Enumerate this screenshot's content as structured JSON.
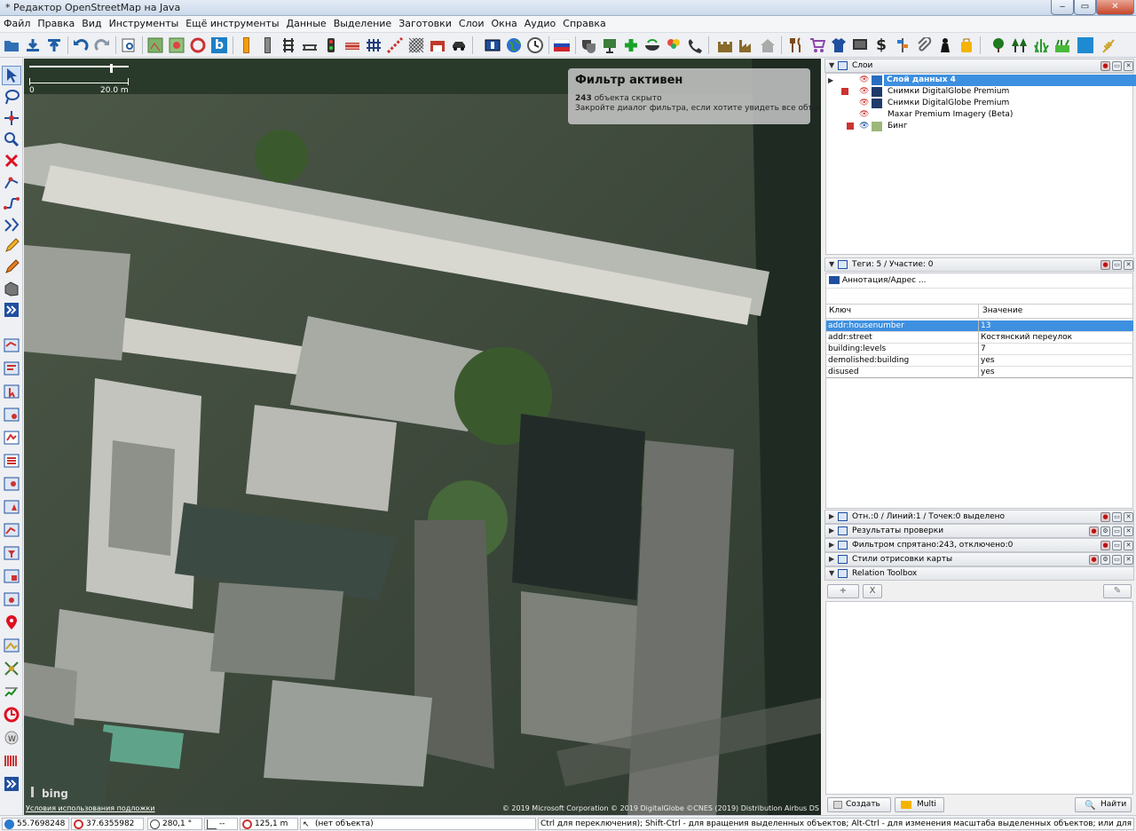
{
  "window": {
    "title": "* Редактор OpenStreetMap на Java",
    "buttons": [
      "‒",
      "▭",
      "✕"
    ]
  },
  "menu": [
    "Файл",
    "Правка",
    "Вид",
    "Инструменты",
    "Ещё инструменты",
    "Данные",
    "Выделение",
    "Заготовки",
    "Слои",
    "Окна",
    "Аудио",
    "Справка"
  ],
  "map": {
    "scale": {
      "zero": "0",
      "end": "20.0 m"
    },
    "filter": {
      "title": "Фильтр активен",
      "count": "243",
      "hidden_text": " объекта скрыто",
      "hint": "Закройте диалог фильтра, если хотите увидеть все объекты."
    },
    "bing_logo": "bing",
    "terms": "Условия использования подложки",
    "attribution": "© 2019 Microsoft Corporation © 2019 DigitalGlobe ©CNES (2019) Distribution Airbus DS"
  },
  "layers_panel": {
    "title": "Слои",
    "items": [
      {
        "label": "Слой данных 4",
        "selected": true
      },
      {
        "label": "Снимки DigitalGlobe Premium",
        "selected": false
      },
      {
        "label": "Снимки DigitalGlobe Premium",
        "selected": false
      },
      {
        "label": "Maxar Premium Imagery (Beta)",
        "selected": false
      },
      {
        "label": "Бинг",
        "selected": false
      }
    ]
  },
  "tags_panel": {
    "title": "Теги: 5 / Участие: 0",
    "preset": "Аннотация/Адрес ...",
    "col_key": "Ключ",
    "col_value": "Значение",
    "rows": [
      {
        "key": "addr:housenumber",
        "value": "13",
        "selected": true
      },
      {
        "key": "addr:street",
        "value": "Костянский переулок",
        "selected": false
      },
      {
        "key": "building:levels",
        "value": "7",
        "selected": false
      },
      {
        "key": "demolished:building",
        "value": "yes",
        "selected": false
      },
      {
        "key": "disused",
        "value": "yes",
        "selected": false
      }
    ]
  },
  "collapsed_panels": [
    {
      "label": "Отн.:0 / Линий:1 / Точек:0 выделено"
    },
    {
      "label": "Результаты проверки"
    },
    {
      "label": "Фильтром спрятано:243, отключено:0"
    },
    {
      "label": "Стили отрисовки карты"
    }
  ],
  "relation_toolbox": {
    "title": "Relation Toolbox",
    "add": "+",
    "remove": "X",
    "edit": "✎"
  },
  "bottom_buttons": {
    "create": "Создать",
    "multi": "Multi",
    "find": "Найти"
  },
  "status": {
    "lat": "55.7698248",
    "lon": "37.6355982",
    "heading": "280,1 °",
    "angle": "--",
    "distance": "125,1 m",
    "object": "(нет объекта)",
    "hint": "Ctrl для переключения); Shift-Ctrl - для вращения выделенных объектов; Alt-Ctrl - для изменения масштаба выделенных объектов; или для изменения выделения"
  }
}
